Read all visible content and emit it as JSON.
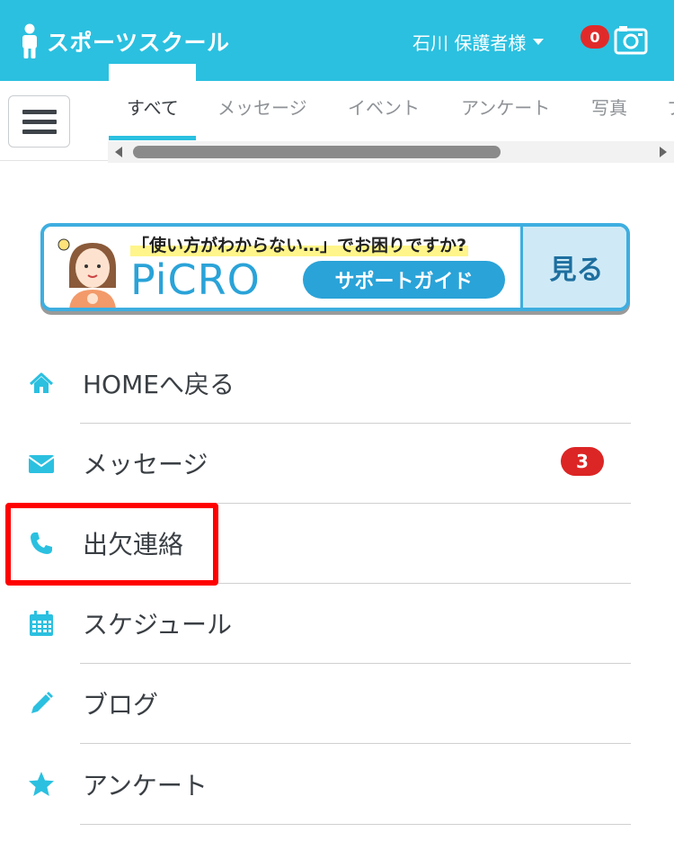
{
  "header": {
    "app_name": "スポーツスクール",
    "user_label": "石川 保護者様",
    "notification_count": "0",
    "icons": {
      "logo": "person-icon",
      "camera": "camera-icon",
      "user_menu": "caret-down-icon"
    }
  },
  "menu_button": {
    "icon": "hamburger-icon"
  },
  "tabs": [
    {
      "label": "すべて",
      "active": true
    },
    {
      "label": "メッセージ",
      "active": false
    },
    {
      "label": "イベント",
      "active": false
    },
    {
      "label": "アンケート",
      "active": false
    },
    {
      "label": "写真",
      "active": false
    },
    {
      "label": "ブ",
      "active": false
    }
  ],
  "banner": {
    "question": "「使い方がわからない…」でお困りですか?",
    "logo": "PiCRO",
    "guide": "サポートガイド",
    "see": "見る"
  },
  "nav": [
    {
      "label": "HOMEへ戻る",
      "icon": "home-icon"
    },
    {
      "label": "メッセージ",
      "icon": "envelope-icon",
      "badge": "3"
    },
    {
      "label": "出欠連絡",
      "icon": "phone-icon",
      "highlighted": true
    },
    {
      "label": "スケジュール",
      "icon": "calendar-icon"
    },
    {
      "label": "ブログ",
      "icon": "pencil-icon"
    },
    {
      "label": "アンケート",
      "icon": "star-icon"
    }
  ],
  "colors": {
    "accent": "#2bc0e0",
    "badge": "#dc2525",
    "highlight": "#ff0000",
    "banner_blue": "#2aa3d8"
  }
}
